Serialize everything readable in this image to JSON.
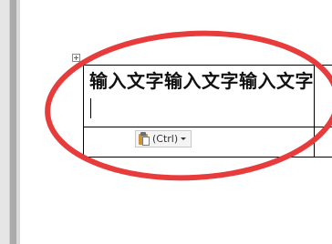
{
  "document": {
    "cell_text": "输入文字输入文字输入文字"
  },
  "paste_options": {
    "label": "(Ctrl)",
    "icon": "clipboard-icon"
  },
  "annotation": {
    "color": "#e83b3b"
  }
}
